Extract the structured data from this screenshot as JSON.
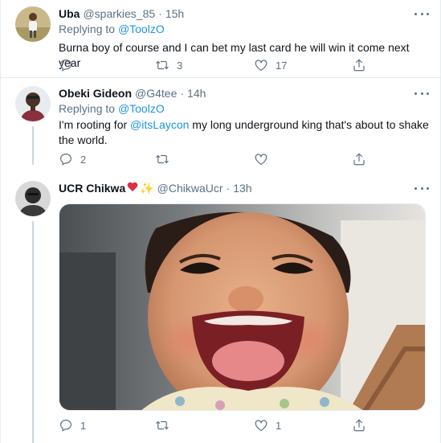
{
  "tweets": [
    {
      "name": "Uba",
      "handle": "@sparkies_85",
      "time": "15h",
      "replying_prefix": "Replying to",
      "replying_to": "@ToolzO",
      "text": "Burna boy of course and I can bet my last card he will win it come next year",
      "reply_count": "",
      "retweet_count": "3",
      "like_count": "17"
    },
    {
      "name": "Obeki Gideon",
      "handle": "@G4tee",
      "time": "14h",
      "replying_prefix": "Replying to",
      "replying_to": "@ToolzO",
      "text_before": "I'm rooting for ",
      "text_mention": "@itsLaycon",
      "text_after": " my long underground king that's about to shake the world.",
      "reply_count": "2",
      "retweet_count": "",
      "like_count": ""
    },
    {
      "name": "UCR Chikwa",
      "handle": "@ChikwaUcr",
      "time": "13h",
      "media": "photo of a laughing baby",
      "reply_count": "1",
      "retweet_count": "",
      "like_count": "1"
    }
  ],
  "separator": "·",
  "icons": {
    "reply": "reply-icon",
    "retweet": "retweet-icon",
    "like": "heart-outline-icon",
    "share": "share-icon",
    "more": "more-icon"
  },
  "colors": {
    "link": "#1b95e0",
    "secondary_text": "#5b7083",
    "divider": "#e6ecf0",
    "thread_line": "#ccd6dd"
  }
}
